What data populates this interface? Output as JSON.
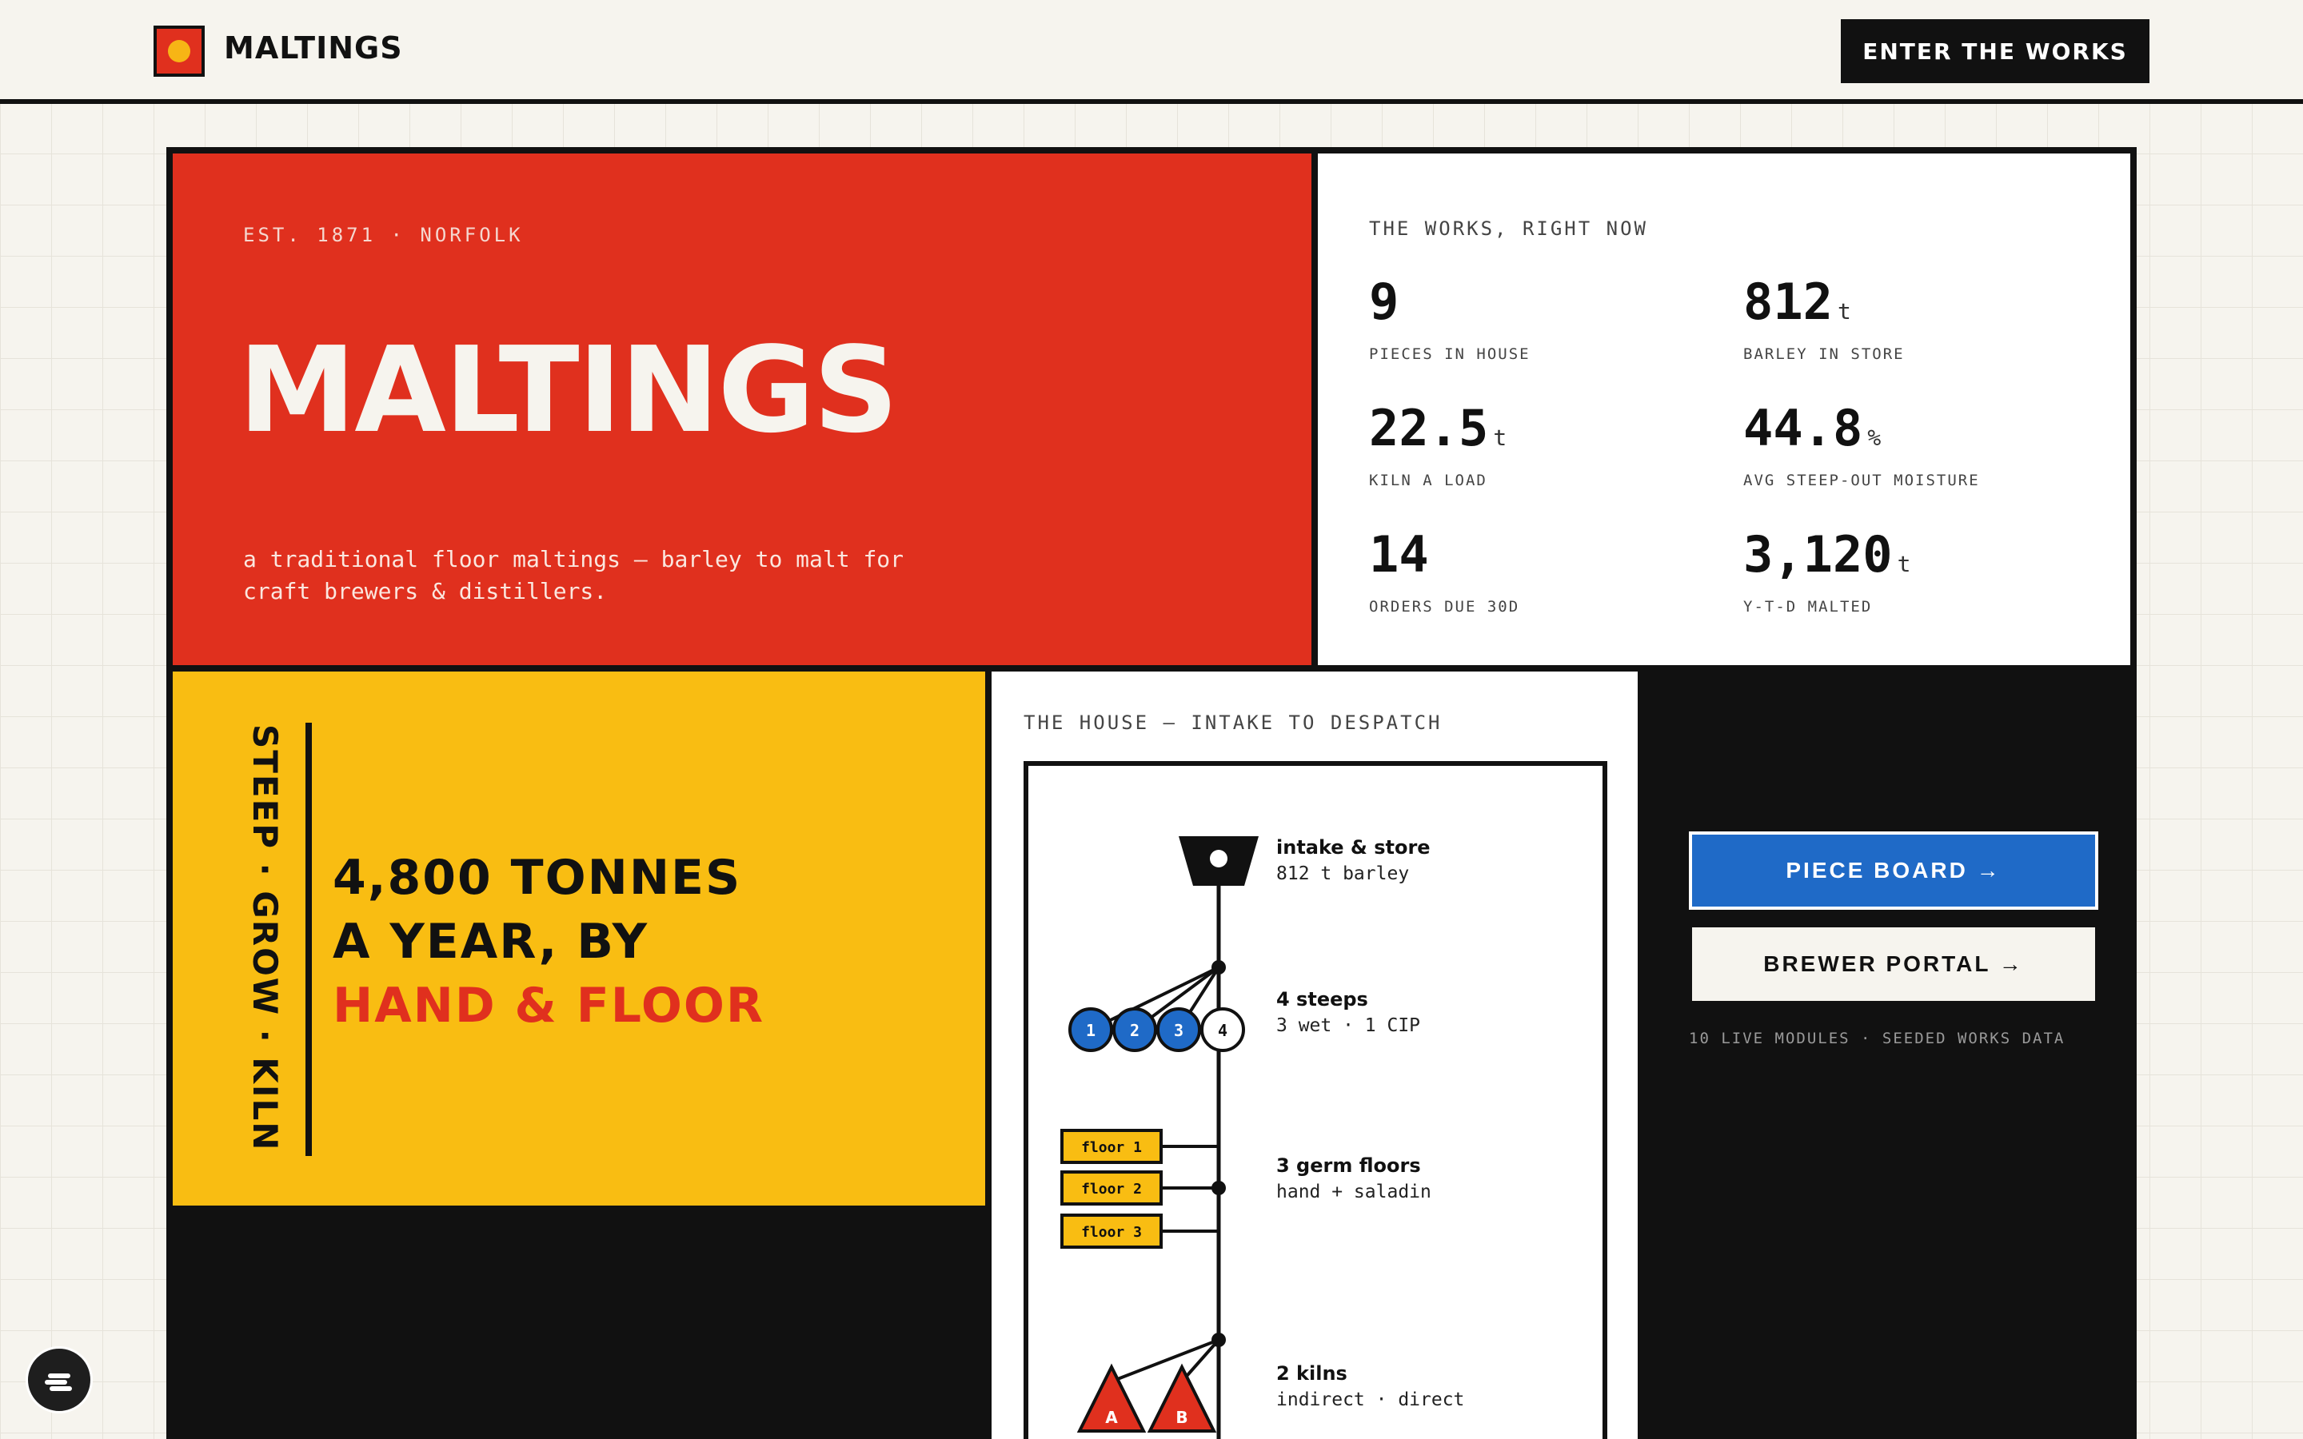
{
  "header": {
    "brand": "MALTINGS",
    "cta_label": "ENTER THE WORKS"
  },
  "hero": {
    "est": "EST. 1871 · NORFOLK",
    "title": "MALTINGS",
    "tagline": "a traditional floor maltings — barley to malt for craft brewers & distillers."
  },
  "stats": {
    "heading": "THE WORKS, RIGHT NOW",
    "items": [
      {
        "value": "9",
        "unit": "",
        "label": "PIECES IN HOUSE"
      },
      {
        "value": "812",
        "unit": "t",
        "label": "BARLEY IN STORE"
      },
      {
        "value": "22.5",
        "unit": "t",
        "label": "KILN A LOAD"
      },
      {
        "value": "44.8",
        "unit": "%",
        "label": "AVG STEEP-OUT MOISTURE"
      },
      {
        "value": "14",
        "unit": "",
        "label": "ORDERS DUE 30D"
      },
      {
        "value": "3,120",
        "unit": "t",
        "label": "Y-T-D MALTED"
      }
    ]
  },
  "process": {
    "vertical": "STEEP · GROW · KILN",
    "line1": "4,800 TONNES",
    "line2": "A YEAR, BY",
    "line3": "HAND & FLOOR"
  },
  "house": {
    "heading": "THE HOUSE — INTAKE TO DESPATCH",
    "steps": [
      {
        "title": "intake & store",
        "sub": "812 t barley"
      },
      {
        "title": "4 steeps",
        "sub": "3 wet · 1 CIP"
      },
      {
        "title": "3 germ floors",
        "sub": "hand + saladin"
      },
      {
        "title": "2 kilns",
        "sub": "indirect · direct"
      }
    ],
    "steep_labels": [
      "1",
      "2",
      "3",
      "4"
    ],
    "floor_labels": [
      "floor 1",
      "floor 2",
      "floor 3"
    ],
    "kiln_labels": [
      "A",
      "B"
    ]
  },
  "actions": {
    "piece_board": "PIECE BOARD →",
    "brewer_portal": "BREWER PORTAL →",
    "note": "10 LIVE MODULES · SEEDED WORKS DATA"
  },
  "colors": {
    "red": "#e0301e",
    "yellow": "#f9bd12",
    "blue": "#1f6ac7",
    "ink": "#111111",
    "paper": "#f6f4ee"
  }
}
